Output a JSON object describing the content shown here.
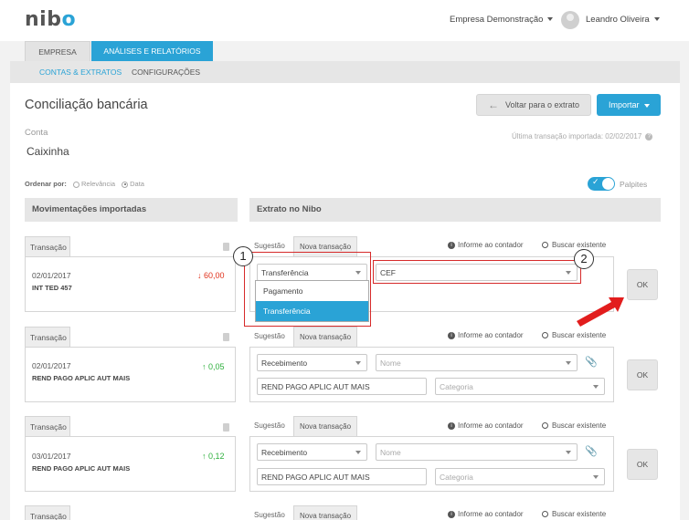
{
  "header": {
    "logo_prefix": "nib",
    "logo_suffix": "o",
    "company": "Empresa Demonstração",
    "user": "Leandro Oliveira"
  },
  "tabs": [
    {
      "label": "EMPRESA"
    },
    {
      "label": "ANÁLISES E RELATÓRIOS"
    }
  ],
  "subnav": [
    {
      "label": "CONTAS & EXTRATOS"
    },
    {
      "label": "CONFIGURAÇÕES"
    }
  ],
  "page": {
    "title": "Conciliação bancária",
    "back_button": "Voltar para o extrato",
    "import_button": "Importar",
    "conta_label": "Conta",
    "conta_value": "Caixinha",
    "last_import": "Última transação importada: 02/02/2017",
    "order_label": "Ordenar por:",
    "order_options": [
      "Relevância",
      "Data"
    ],
    "palpites_label": "Palpites",
    "left_header": "Movimentações importadas",
    "right_header": "Extrato no Nibo"
  },
  "colors": {
    "accent": "#2aa3d6",
    "negative": "#e0311b",
    "positive": "#2fb03e",
    "annotation": "#d62a2a"
  },
  "common": {
    "tx_tab": "Transação",
    "sugestao": "Sugestão",
    "nova": "Nova transação",
    "informe": "Informe ao contador",
    "buscar": "Buscar existente",
    "ok": "OK",
    "nome_ph": "Nome",
    "categoria_ph": "Categoria"
  },
  "rows": [
    {
      "date": "02/01/2017",
      "desc": "INT TED 457",
      "amount": "60,00",
      "direction": "down",
      "type": "Transferência",
      "account": "CEF"
    },
    {
      "date": "02/01/2017",
      "desc": "REND PAGO APLIC AUT MAIS",
      "amount": "0,05",
      "direction": "up",
      "type": "Recebimento",
      "memo": "REND PAGO APLIC AUT MAIS"
    },
    {
      "date": "03/01/2017",
      "desc": "REND PAGO APLIC AUT MAIS",
      "amount": "0,12",
      "direction": "up",
      "type": "Recebimento",
      "memo": "REND PAGO APLIC AUT MAIS"
    }
  ],
  "dropdown_options": [
    "Pagamento",
    "Transferência"
  ],
  "annotations": [
    "1",
    "2"
  ]
}
